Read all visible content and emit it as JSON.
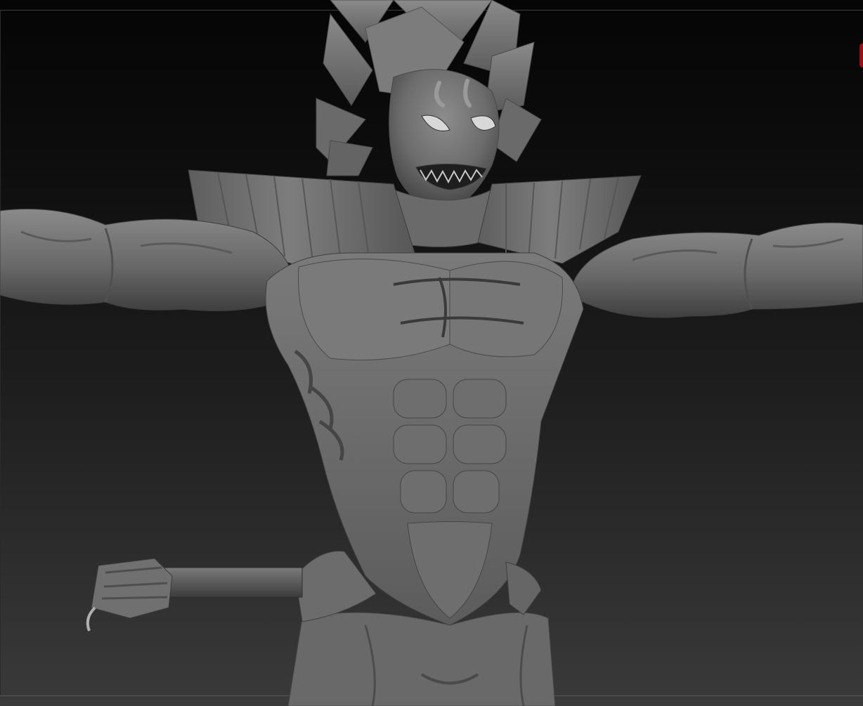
{
  "viewport": {
    "background_top": "#050505",
    "background_bottom": "#3a3a3a",
    "edge_marker_color": "#9a1010"
  },
  "model": {
    "material_base": "#6e6e6e",
    "material_light": "#8a8a8a",
    "material_dark": "#4a4a4a"
  }
}
